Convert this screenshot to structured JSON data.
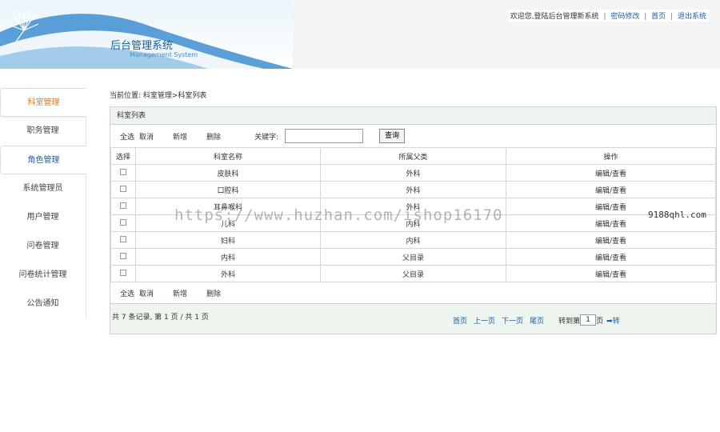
{
  "header": {
    "title": "后台管理系统",
    "subtitle": "Management System",
    "welcome": "欢迎您,登陆后台管理新系统",
    "links": [
      "密码修改",
      "首页",
      "退出系统"
    ]
  },
  "sidebar": {
    "items": [
      {
        "label": "科室管理"
      },
      {
        "label": "职务管理"
      },
      {
        "label": "角色管理"
      },
      {
        "label": "系统管理员"
      },
      {
        "label": "用户管理"
      },
      {
        "label": "问卷管理"
      },
      {
        "label": "问卷统计管理"
      },
      {
        "label": "公告通知"
      }
    ]
  },
  "breadcrumb": "当前位置: 科室管理>科室列表",
  "panel": {
    "title": "科室列表",
    "toolbar": {
      "select_all": "全选",
      "cancel": "取消",
      "add": "新增",
      "delete": "删除",
      "keyword_label": "关键字:",
      "keyword_value": "",
      "search_button": "查询"
    },
    "table": {
      "columns": [
        "选择",
        "科室名称",
        "所属父类",
        "操作"
      ],
      "rows": [
        {
          "name": "皮肤科",
          "parent": "外科",
          "action": "编辑/查看"
        },
        {
          "name": "口腔科",
          "parent": "外科",
          "action": "编辑/查看"
        },
        {
          "name": "耳鼻喉科",
          "parent": "外科",
          "action": "编辑/查看"
        },
        {
          "name": "儿科",
          "parent": "内科",
          "action": "编辑/查看"
        },
        {
          "name": "妇科",
          "parent": "内科",
          "action": "编辑/查看"
        },
        {
          "name": "内科",
          "parent": "父目录",
          "action": "编辑/查看"
        },
        {
          "name": "外科",
          "parent": "父目录",
          "action": "编辑/查看"
        }
      ]
    },
    "bottom_toolbar": {
      "select_all": "全选",
      "cancel": "取消",
      "add": "新增",
      "delete": "删除"
    },
    "footer": {
      "records": "共 7 条记录, 第 1 页 / 共 1 页",
      "first": "首页",
      "prev": "上一页",
      "next": "下一页",
      "last": "尾页",
      "jump_label": "转到第",
      "page_value": "1",
      "page_suffix": "页",
      "go": "➡转"
    }
  },
  "watermark": {
    "url": "https://www.huzhan.com/ishop16170",
    "site": "9188qhl.com"
  }
}
